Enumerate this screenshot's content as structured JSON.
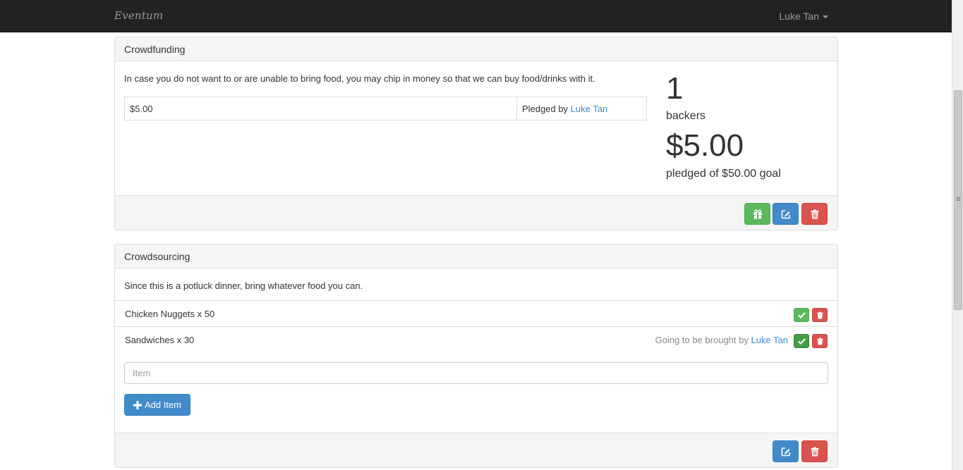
{
  "navbar": {
    "brand": "Eventum",
    "user_name": "Luke Tan"
  },
  "crowdfunding": {
    "title": "Crowdfunding",
    "description": "In case you do not want to or are unable to bring food, you may chip in money so that we can buy food/drinks with it.",
    "pledges": [
      {
        "amount": "$5.00",
        "pledged_by_prefix": "Pledged by ",
        "pledged_by": "Luke Tan"
      }
    ],
    "backers_count": "1",
    "backers_label": "backers",
    "pledged_amount": "$5.00",
    "goal_text": "pledged of $50.00 goal",
    "footer_buttons": [
      "gift-icon",
      "edit-icon",
      "trash-icon"
    ]
  },
  "crowdsourcing": {
    "title": "Crowdsourcing",
    "description": "Since this is a potluck dinner, bring whatever food you can.",
    "items": [
      {
        "label": "Chicken Nuggets x 50",
        "note_prefix": "",
        "note_user": ""
      },
      {
        "label": "Sandwiches x 30",
        "note_prefix": "Going to be brought by ",
        "note_user": "Luke Tan"
      }
    ],
    "input_placeholder": "Item",
    "add_button_label": "Add Item",
    "footer_buttons": [
      "edit-icon",
      "trash-icon"
    ]
  },
  "colors": {
    "navbar": "#222222",
    "success": "#5cb85c",
    "primary": "#428bca",
    "danger": "#d9534f",
    "link": "#428bca"
  }
}
